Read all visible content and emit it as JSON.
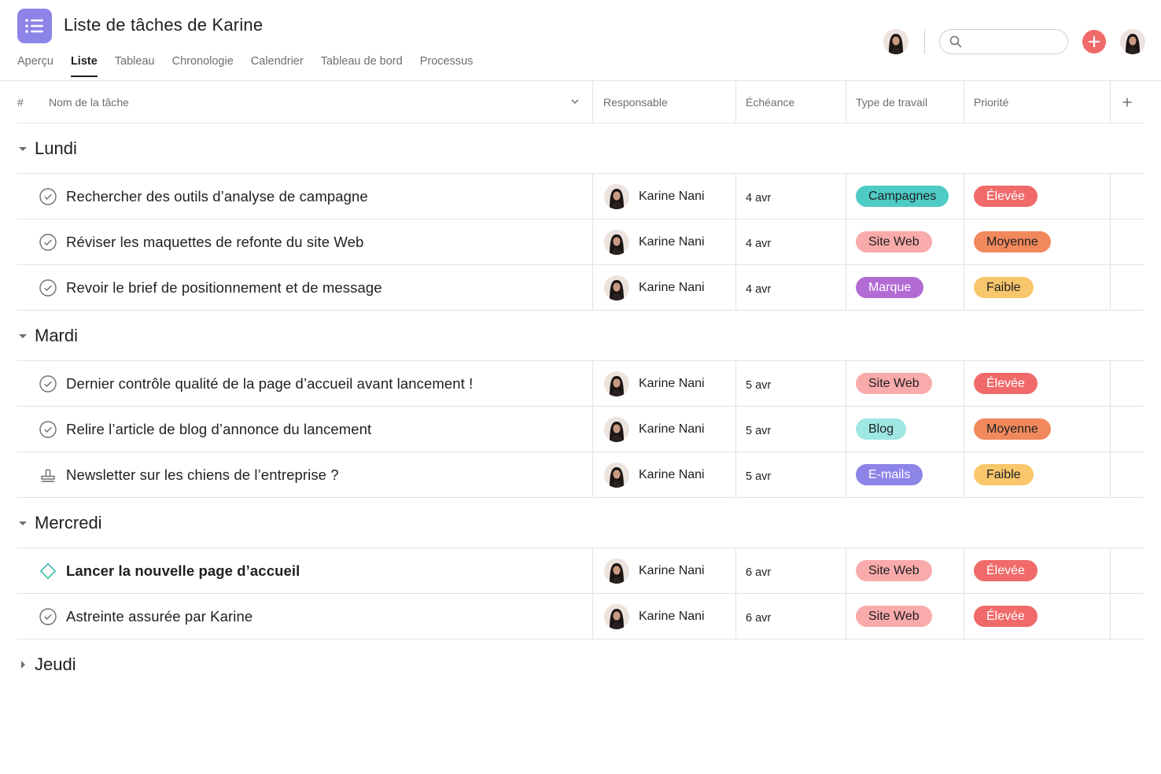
{
  "header": {
    "title": "Liste de tâches de Karine",
    "tabs": [
      {
        "label": "Aperçu",
        "active": false
      },
      {
        "label": "Liste",
        "active": true
      },
      {
        "label": "Tableau",
        "active": false
      },
      {
        "label": "Chronologie",
        "active": false
      },
      {
        "label": "Calendrier",
        "active": false
      },
      {
        "label": "Tableau de bord",
        "active": false
      },
      {
        "label": "Processus",
        "active": false
      }
    ],
    "search_placeholder": "",
    "accent_color": "#8d84e8",
    "add_button_color": "#f06a6a"
  },
  "columns": {
    "hash": "#",
    "name": "Nom de la tâche",
    "assignee": "Responsable",
    "due": "Échéance",
    "type": "Type de travail",
    "priority": "Priorité",
    "add": "+"
  },
  "colors": {
    "Campagnes": {
      "bg": "#4ecbc4",
      "fg": "#1e1f21"
    },
    "Site Web": {
      "bg": "#f9aaaa",
      "fg": "#1e1f21"
    },
    "Marque": {
      "bg": "#b36bd4",
      "fg": "#ffffff"
    },
    "Blog": {
      "bg": "#9ee7e3",
      "fg": "#1e1f21"
    },
    "E-mails": {
      "bg": "#8d84e8",
      "fg": "#ffffff"
    },
    "Élevée": {
      "bg": "#f06a6a",
      "fg": "#ffffff"
    },
    "Moyenne": {
      "bg": "#f1895c",
      "fg": "#1e1f21"
    },
    "Faible": {
      "bg": "#f8c66b",
      "fg": "#1e1f21"
    }
  },
  "sections": [
    {
      "title": "Lundi",
      "expanded": true,
      "tasks": [
        {
          "title": "Rechercher des outils d’analyse de campagne",
          "icon": "check",
          "assignee": "Karine Nani",
          "due": "4 avr",
          "type": "Campagnes",
          "priority": "Élevée"
        },
        {
          "title": "Réviser les maquettes de refonte du site Web",
          "icon": "check",
          "assignee": "Karine Nani",
          "due": "4 avr",
          "type": "Site Web",
          "priority": "Moyenne"
        },
        {
          "title": "Revoir le brief de positionnement et de message",
          "icon": "check",
          "assignee": "Karine Nani",
          "due": "4 avr",
          "type": "Marque",
          "priority": "Faible"
        }
      ]
    },
    {
      "title": "Mardi",
      "expanded": true,
      "tasks": [
        {
          "title": "Dernier contrôle qualité de la page d’accueil avant lancement !",
          "icon": "check",
          "assignee": "Karine Nani",
          "due": "5 avr",
          "type": "Site Web",
          "priority": "Élevée"
        },
        {
          "title": "Relire l’article de blog d’annonce du lancement",
          "icon": "check",
          "assignee": "Karine Nani",
          "due": "5 avr",
          "type": "Blog",
          "priority": "Moyenne"
        },
        {
          "title": "Newsletter sur les chiens de l’entreprise ?",
          "icon": "approval",
          "assignee": "Karine Nani",
          "due": "5 avr",
          "type": "E-mails",
          "priority": "Faible"
        }
      ]
    },
    {
      "title": "Mercredi",
      "expanded": true,
      "tasks": [
        {
          "title": "Lancer la nouvelle page d’accueil",
          "icon": "milestone",
          "bold": true,
          "assignee": "Karine Nani",
          "due": "6 avr",
          "type": "Site Web",
          "priority": "Élevée"
        },
        {
          "title": "Astreinte assurée par Karine",
          "icon": "check",
          "assignee": "Karine Nani",
          "due": "6 avr",
          "type": "Site Web",
          "priority": "Élevée"
        }
      ]
    },
    {
      "title": "Jeudi",
      "expanded": false,
      "tasks": []
    }
  ]
}
